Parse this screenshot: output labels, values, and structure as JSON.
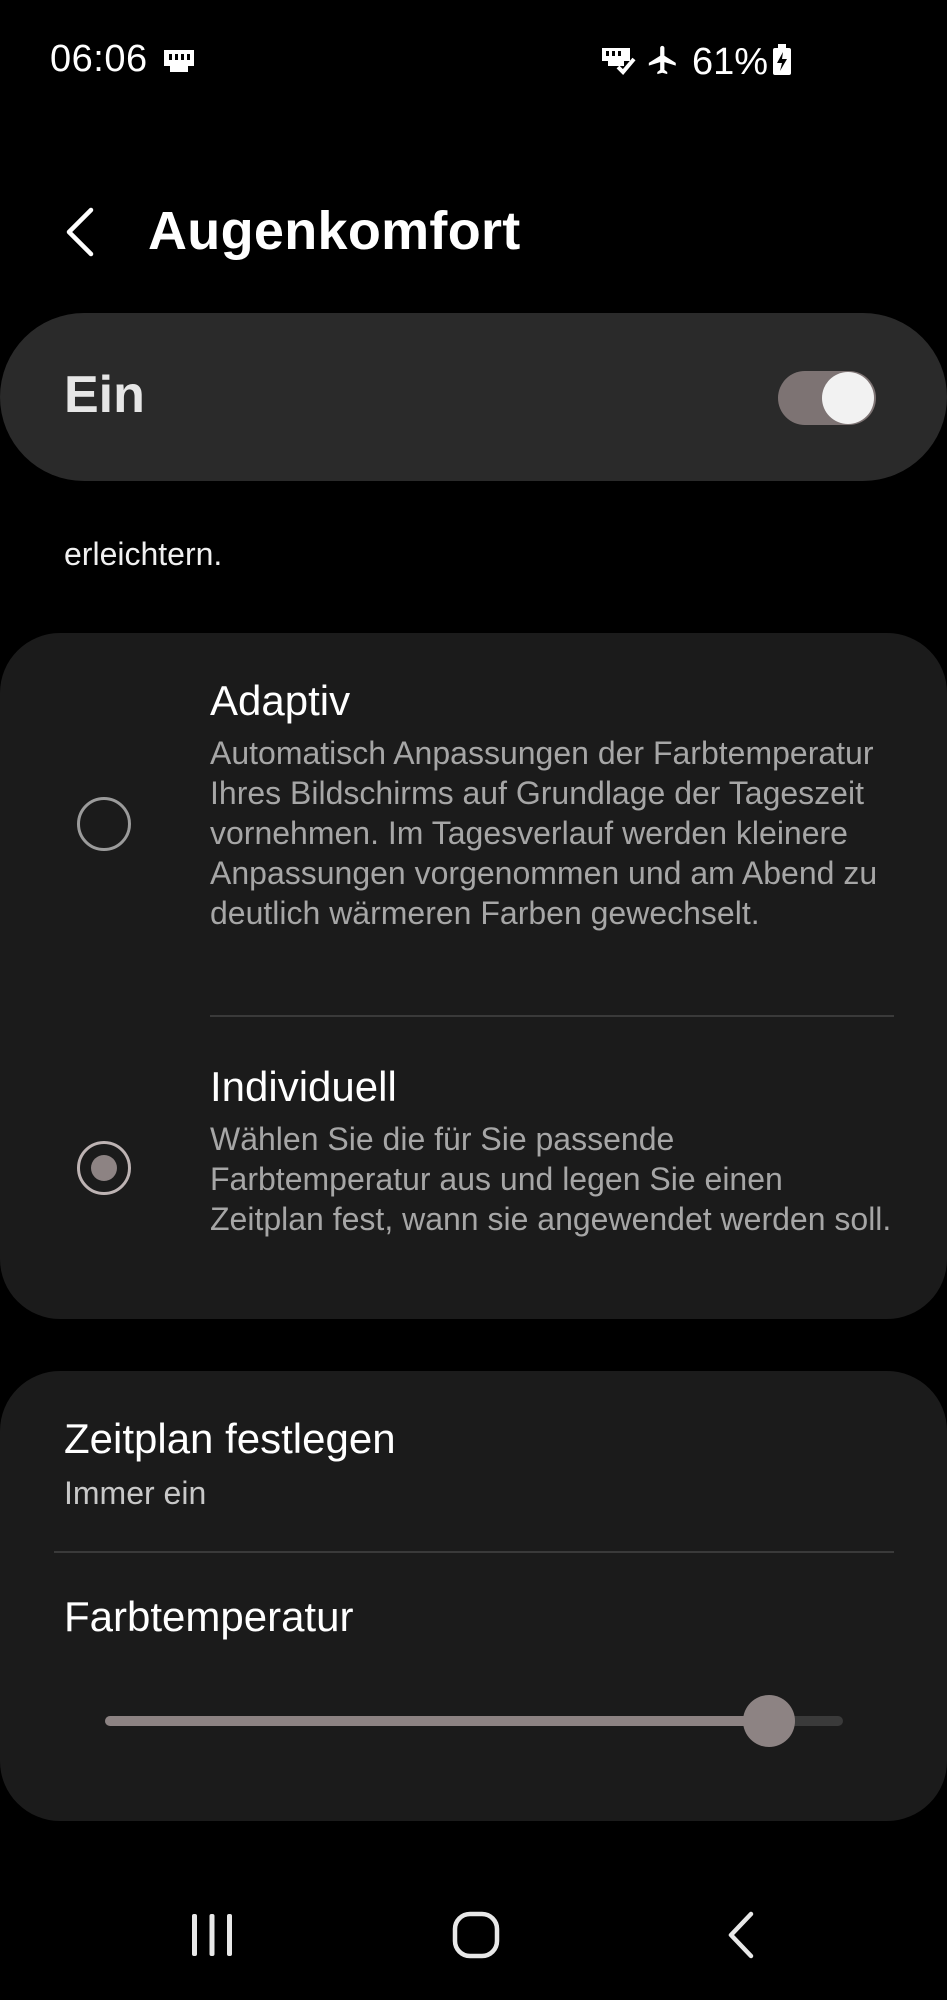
{
  "status_bar": {
    "time": "06:06",
    "left_icons": [
      "sim-card-icon"
    ],
    "right_icons": [
      "vpn-check-icon",
      "airplane-mode-icon"
    ],
    "battery_percent": "61%",
    "battery_icon": "battery-charging-icon"
  },
  "app_bar": {
    "back_icon": "chevron-left-icon",
    "title": "Augenkomfort"
  },
  "master_toggle": {
    "label": "Ein",
    "checked": true,
    "track_color": "#7d7373"
  },
  "description": {
    "text": "erleichtern."
  },
  "modes": {
    "options": [
      {
        "title": "Adaptiv",
        "description": "Automatisch Anpassungen der Farbtemperatur Ihres Bildschirms auf Grundlage der Tageszeit vornehmen. Im Tagesverlauf werden kleinere Anpassungen vorgenommen und am Abend zu deutlich wärmeren Farben gewechselt.",
        "selected": false
      },
      {
        "title": "Individuell",
        "description": "Wählen Sie die für Sie passende Farbtemperatur aus und legen Sie einen Zeitplan fest, wann sie angewendet werden soll.",
        "selected": true
      }
    ]
  },
  "schedule": {
    "title": "Zeitplan festlegen",
    "value": "Immer ein"
  },
  "color_temperature": {
    "title": "Farbtemperatur",
    "level_fraction": 0.9,
    "accent_color": "#8d8383"
  },
  "nav_bar": {
    "recents_icon": "recent-apps-icon",
    "home_icon": "home-icon",
    "back_icon": "back-icon"
  }
}
